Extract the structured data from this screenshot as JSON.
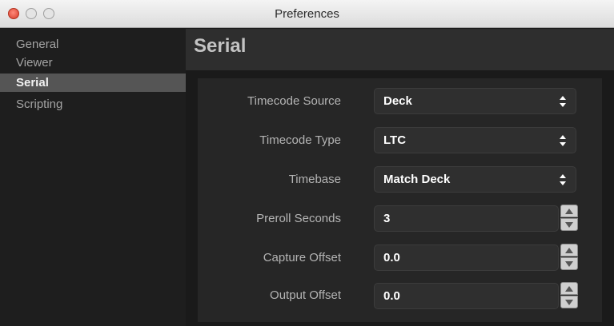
{
  "window": {
    "title": "Preferences"
  },
  "sidebar": {
    "items": [
      {
        "label": "General"
      },
      {
        "label": "Viewer"
      },
      {
        "label": "Serial"
      },
      {
        "label": "Scripting"
      }
    ],
    "active": "Serial"
  },
  "panel": {
    "title": "Serial",
    "fields": {
      "timecode_source": {
        "label": "Timecode Source",
        "value": "Deck"
      },
      "timecode_type": {
        "label": "Timecode Type",
        "value": "LTC"
      },
      "timebase": {
        "label": "Timebase",
        "value": "Match Deck"
      },
      "preroll_seconds": {
        "label": "Preroll Seconds",
        "value": "3"
      },
      "capture_offset": {
        "label": "Capture Offset",
        "value": "0.0"
      },
      "output_offset": {
        "label": "Output Offset",
        "value": "0.0"
      }
    }
  },
  "colors": {
    "background": "#1a1a1a",
    "sidebar_active": "#555555",
    "header_band": "#2e2e2e",
    "label_text": "#b4b4b4",
    "value_text": "#ffffff"
  },
  "icons": {
    "traffic_lights": [
      "close-icon",
      "minimize-icon",
      "zoom-icon"
    ],
    "select": "up-down-arrows-icon",
    "stepper": [
      "stepper-up-icon",
      "stepper-down-icon"
    ]
  }
}
